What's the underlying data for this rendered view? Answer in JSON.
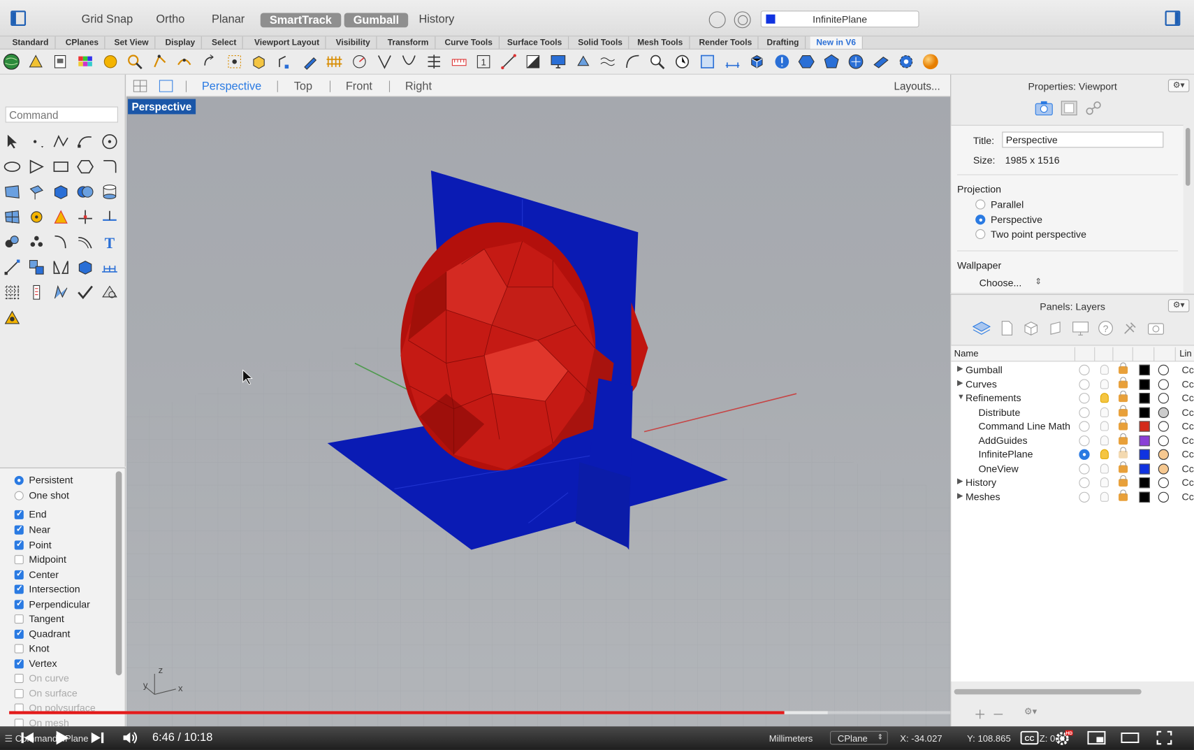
{
  "topbar": {
    "modes": [
      "Grid Snap",
      "Ortho",
      "Planar",
      "SmartTrack",
      "Gumball",
      "History"
    ],
    "current_layer": "InfinitePlane",
    "layer_color": "#1033e0"
  },
  "tabs": [
    "Standard",
    "CPlanes",
    "Set View",
    "Display",
    "Select",
    "Viewport Layout",
    "Visibility",
    "Transform",
    "Curve Tools",
    "Surface Tools",
    "Solid Tools",
    "Mesh Tools",
    "Render Tools",
    "Drafting",
    "New in V6"
  ],
  "active_tab": "New in V6",
  "command": {
    "placeholder": "Command"
  },
  "viewport_tabs": {
    "items": [
      "Perspective",
      "Top",
      "Front",
      "Right"
    ],
    "active": "Perspective",
    "layouts": "Layouts..."
  },
  "viewport": {
    "label": "Perspective",
    "axis_x": "x",
    "axis_y": "y",
    "axis_z": "z"
  },
  "osnap": {
    "modes": [
      {
        "label": "Persistent",
        "kind": "radio",
        "checked": true
      },
      {
        "label": "One shot",
        "kind": "radio",
        "checked": false
      }
    ],
    "snaps": [
      {
        "label": "End",
        "checked": true
      },
      {
        "label": "Near",
        "checked": true
      },
      {
        "label": "Point",
        "checked": true
      },
      {
        "label": "Midpoint",
        "checked": false
      },
      {
        "label": "Center",
        "checked": true
      },
      {
        "label": "Intersection",
        "checked": true
      },
      {
        "label": "Perpendicular",
        "checked": true
      },
      {
        "label": "Tangent",
        "checked": false
      },
      {
        "label": "Quadrant",
        "checked": true
      },
      {
        "label": "Knot",
        "checked": false
      },
      {
        "label": "Vertex",
        "checked": true
      },
      {
        "label": "On curve",
        "checked": false,
        "disabled": true
      },
      {
        "label": "On surface",
        "checked": false,
        "disabled": true
      },
      {
        "label": "On polysurface",
        "checked": false,
        "disabled": true
      },
      {
        "label": "On mesh",
        "checked": false,
        "disabled": true
      }
    ]
  },
  "properties": {
    "title": "Properties: Viewport",
    "title_label": "Title:",
    "title_value": "Perspective",
    "size_label": "Size:",
    "size_value": "1985 x 1516",
    "projection_heading": "Projection",
    "projections": [
      {
        "label": "Parallel",
        "selected": false
      },
      {
        "label": "Perspective",
        "selected": true
      },
      {
        "label": "Two point perspective",
        "selected": false
      }
    ],
    "wallpaper_heading": "Wallpaper",
    "wallpaper_choose": "Choose..."
  },
  "layers": {
    "title": "Panels: Layers",
    "col_name": "Name",
    "col_linetype": "Lin",
    "rows": [
      {
        "name": "Gumball",
        "level": 0,
        "expand": "▶",
        "color": "#000000",
        "current": false,
        "lit": false
      },
      {
        "name": "Curves",
        "level": 0,
        "expand": "▶",
        "color": "#000000",
        "current": false,
        "lit": false
      },
      {
        "name": "Refinements",
        "level": 0,
        "expand": "▼",
        "color": "#000000",
        "current": false,
        "lit": true
      },
      {
        "name": "Distribute",
        "level": 1,
        "expand": "",
        "color": "#000000",
        "current": false,
        "lit": false
      },
      {
        "name": "Command Line Math",
        "level": 1,
        "expand": "",
        "color": "#d42a1a",
        "current": false,
        "lit": false
      },
      {
        "name": "AddGuides",
        "level": 1,
        "expand": "",
        "color": "#8a3fd6",
        "current": false,
        "lit": false
      },
      {
        "name": "InfinitePlane",
        "level": 1,
        "expand": "",
        "color": "#1033e0",
        "current": true,
        "lit": true
      },
      {
        "name": "OneView",
        "level": 1,
        "expand": "",
        "color": "#1033e0",
        "current": false,
        "lit": false
      },
      {
        "name": "History",
        "level": 0,
        "expand": "▶",
        "color": "#000000",
        "current": false,
        "lit": false
      },
      {
        "name": "Meshes",
        "level": 0,
        "expand": "▶",
        "color": "#000000",
        "current": false,
        "lit": false
      }
    ],
    "linetype_abbrev": "Cc"
  },
  "statusbar": {
    "command_text": "Command: IPlane",
    "units": "Millimeters",
    "cplane": "CPlane",
    "x": "X: -34.027",
    "y": "Y: 108.865",
    "z": "Z: 0.00"
  },
  "video": {
    "time": "6:46 / 10:18",
    "played_fraction": 0.824,
    "buffered_fraction": 0.87,
    "accent": "#e31b1b"
  }
}
